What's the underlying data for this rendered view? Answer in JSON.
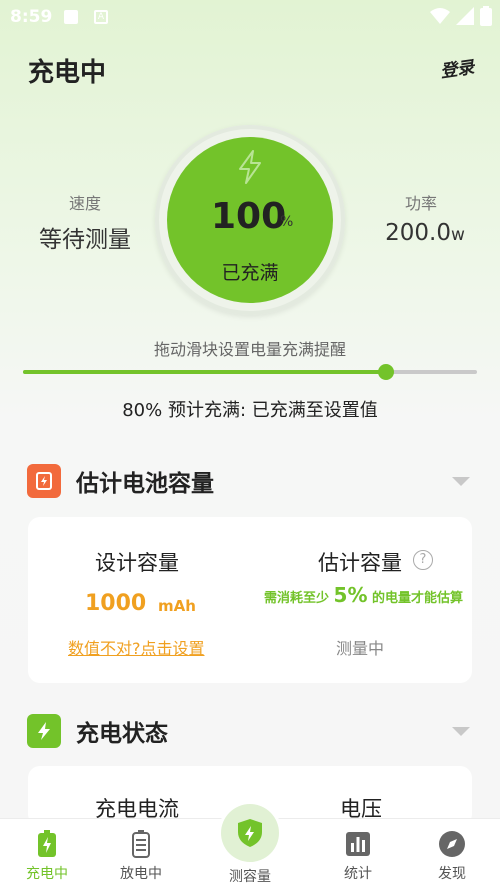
{
  "status_bar": {
    "time": "8:59",
    "notif_badge": "A"
  },
  "header": {
    "title": "充电中",
    "login": "登录"
  },
  "speed": {
    "label": "速度",
    "value": "等待测量"
  },
  "power": {
    "label": "功率",
    "value": "200.0",
    "unit": "w"
  },
  "gauge": {
    "percent": "100",
    "percent_sign": "%",
    "status": "已充满"
  },
  "slider": {
    "hint": "拖动滑块设置电量充满提醒",
    "level": 0.8,
    "info": "80%  预计充满: 已充满至设置值"
  },
  "capacity_section": {
    "title": "估计电池容量",
    "design_label": "设计容量",
    "design_value": "1000",
    "design_unit": "mAh",
    "design_link": "数值不对?点击设置",
    "estimate_label": "估计容量",
    "help": "?",
    "note_prefix": "需消耗至少",
    "note_value": "5%",
    "note_suffix": "的电量才能估算",
    "estimate_status": "测量中"
  },
  "charge_section": {
    "title": "充电状态",
    "current_label": "充电电流",
    "voltage_label": "电压"
  },
  "nav": {
    "items": [
      {
        "label": "充电中"
      },
      {
        "label": "放电中"
      },
      {
        "label": "测容量"
      },
      {
        "label": "统计"
      },
      {
        "label": "发现"
      }
    ]
  },
  "colors": {
    "accent": "#73c32a",
    "orange": "#f0a020",
    "capacity_icon": "#f26a3c"
  }
}
